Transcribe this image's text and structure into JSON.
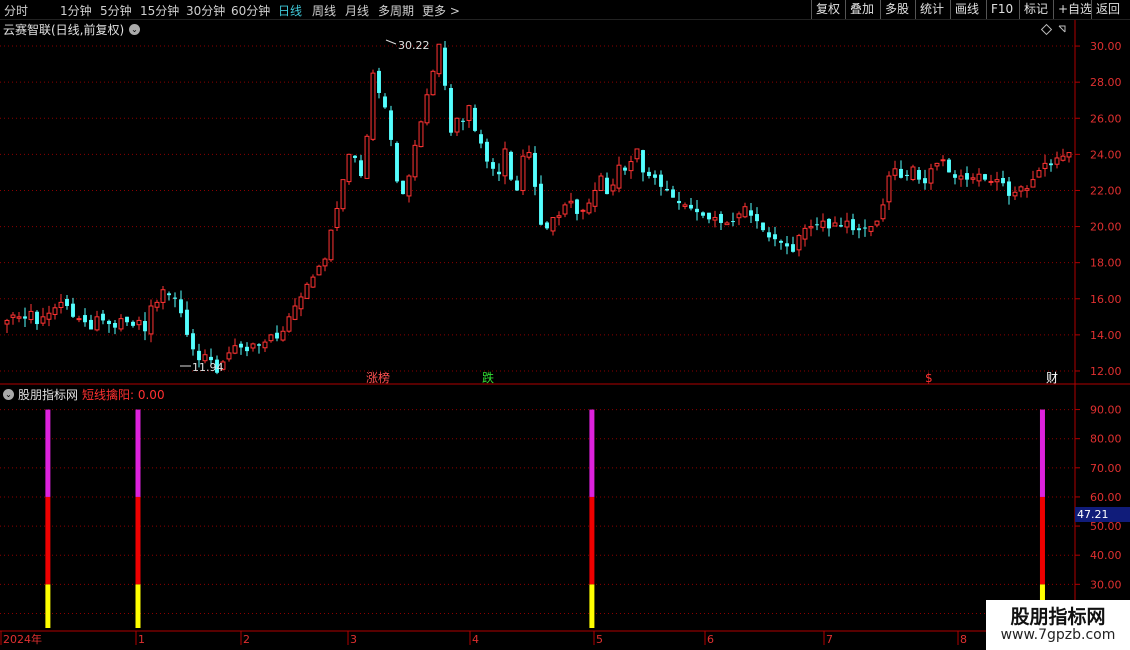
{
  "toolbar": {
    "periods": [
      "分时",
      "1分钟",
      "5分钟",
      "15分钟",
      "30分钟",
      "60分钟",
      "日线",
      "周线",
      "月线",
      "多周期",
      "更多 >"
    ],
    "active_period": "日线",
    "actions": [
      "复权",
      "叠加",
      "多股",
      "统计",
      "画线",
      "F10",
      "标记",
      "+自选",
      "返回"
    ]
  },
  "main_panel": {
    "title": "云赛智联(日线,前复权)",
    "high_label": "30.22",
    "low_label": "11.94",
    "events": [
      {
        "text": "涨榜",
        "color": "#ff5050"
      },
      {
        "text": "跌",
        "color": "#33dd33"
      },
      {
        "text": "$",
        "color": "#ff3030"
      },
      {
        "text": "财",
        "color": "#ffffff"
      }
    ],
    "y_ticks": [
      "30.00",
      "28.00",
      "26.00",
      "24.00",
      "22.00",
      "20.00",
      "18.00",
      "16.00",
      "14.00",
      "12.00"
    ]
  },
  "indicator_panel": {
    "name": "股朋指标网",
    "indicator_label": "短线擒阳: 0.00",
    "y_ticks": [
      "90.00",
      "80.00",
      "70.00",
      "60.00",
      "50.00",
      "40.00",
      "30.00",
      "20.00"
    ],
    "current_value": "47.21"
  },
  "x_axis": {
    "labels": [
      "2024年",
      "1",
      "2",
      "3",
      "4",
      "5",
      "6",
      "7",
      "8"
    ]
  },
  "watermark": {
    "title": "股朋指标网",
    "url": "www.7gpzb.com"
  },
  "colors": {
    "up": "#ff3333",
    "down": "#54ffff",
    "signal_top": "#dd22dd",
    "signal_mid": "#ee0000",
    "signal_bottom": "#ffff00",
    "grid": "#8b0000"
  },
  "chart_data": {
    "type": "candlestick",
    "y_range": [
      11.5,
      31.0
    ],
    "close_prices": [
      14.8,
      15.1,
      15.0,
      14.9,
      15.3,
      14.6,
      15.0,
      15.2,
      15.5,
      15.8,
      15.6,
      15.0,
      14.9,
      14.7,
      14.3,
      15.0,
      14.8,
      14.6,
      14.4,
      14.9,
      14.7,
      14.5,
      14.8,
      14.2,
      15.6,
      15.8,
      16.5,
      16.2,
      16.0,
      15.2,
      14.0,
      13.2,
      12.6,
      12.9,
      12.6,
      11.9,
      12.5,
      13.0,
      13.4,
      13.3,
      13.1,
      13.5,
      13.4,
      13.6,
      14.0,
      13.8,
      14.2,
      15.0,
      15.6,
      16.1,
      16.8,
      17.2,
      17.8,
      18.2,
      19.8,
      21.0,
      22.6,
      24.0,
      23.8,
      22.8,
      25.0,
      28.5,
      27.4,
      26.6,
      24.8,
      22.5,
      21.8,
      22.8,
      24.5,
      25.8,
      27.3,
      28.6,
      30.1,
      27.8,
      25.2,
      26.0,
      25.8,
      26.7,
      25.3,
      24.6,
      23.6,
      23.2,
      22.9,
      24.3,
      22.6,
      22.0,
      23.9,
      24.1,
      22.2,
      20.1,
      19.9,
      20.5,
      20.6,
      21.2,
      21.4,
      20.7,
      20.9,
      21.3,
      22.0,
      22.8,
      21.8,
      22.3,
      23.4,
      23.1,
      23.6,
      24.3,
      23.0,
      22.8,
      22.7,
      22.2,
      22.0,
      21.6,
      21.3,
      21.2,
      21.0,
      20.8,
      20.6,
      20.4,
      20.5,
      20.2,
      20.2,
      20.3,
      20.7,
      21.1,
      20.6,
      20.3,
      19.8,
      19.4,
      19.3,
      19.1,
      18.9,
      18.6,
      19.5,
      19.9,
      20.0,
      20.1,
      20.3,
      19.9,
      20.2,
      20.0,
      20.3,
      19.8,
      19.8,
      19.9,
      20.0,
      20.3,
      21.2,
      22.8,
      23.2,
      22.7,
      22.8,
      23.3,
      22.6,
      22.4,
      23.2,
      23.5,
      23.7,
      23.0,
      22.7,
      22.8,
      22.6,
      22.7,
      22.9,
      22.6,
      22.5,
      22.6,
      22.4,
      21.7,
      21.9,
      22.2,
      22.1,
      22.6,
      23.1,
      23.5,
      23.4,
      23.8,
      23.9,
      24.1
    ],
    "signals": [
      {
        "bar_index": 13,
        "value": 90
      },
      {
        "bar_index": 40,
        "value": 90
      },
      {
        "bar_index": 176,
        "value": 90
      },
      {
        "bar_index": 311,
        "value": 90
      }
    ],
    "signal_layers": [
      30,
      60,
      90
    ],
    "indicator_y_range": [
      15,
      95
    ]
  }
}
